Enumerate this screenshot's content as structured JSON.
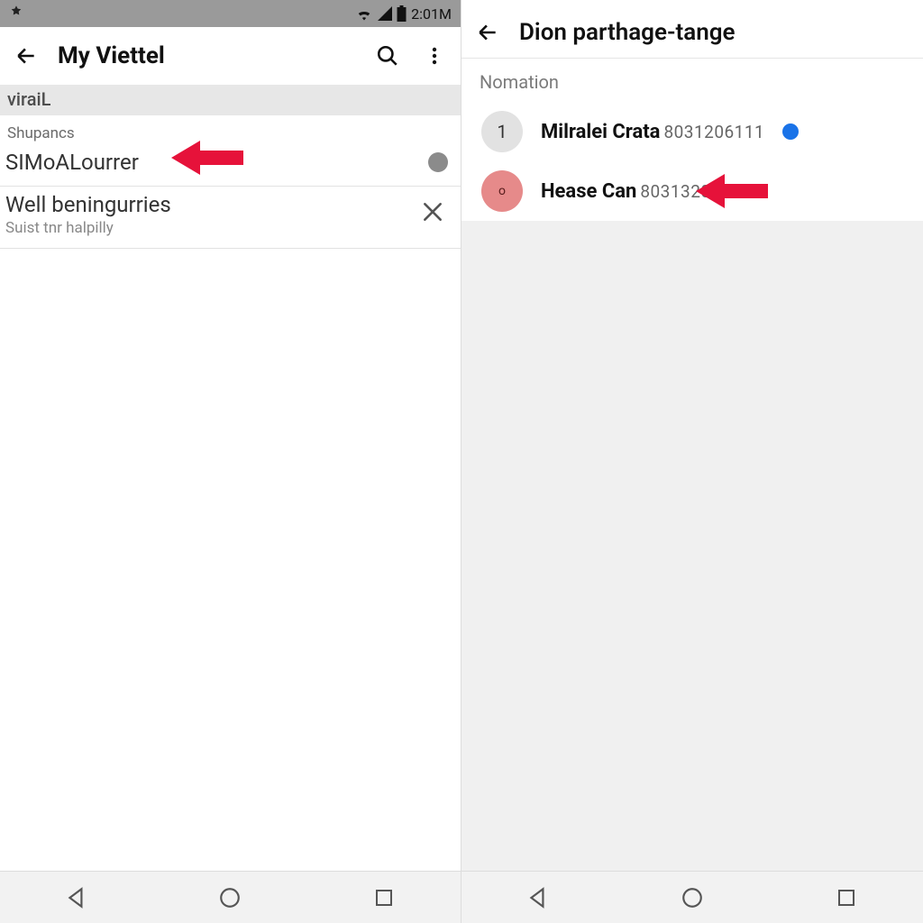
{
  "left": {
    "status": {
      "time": "2:01M"
    },
    "appbar": {
      "title": "My Viettel"
    },
    "strip_label": "viraiL",
    "section_small": "Shupancs",
    "row1": {
      "primary": "SIMoALourrer"
    },
    "row2": {
      "primary": "Well beningurries",
      "secondary": "Suist tnr halpilly"
    }
  },
  "right": {
    "appbar": {
      "title": "Dion parthage-tange"
    },
    "section_label": "Nomation",
    "contacts": [
      {
        "avatar": "1",
        "name": "Milralei Crata",
        "sub": "8031206111",
        "selected": true
      },
      {
        "avatar": "o",
        "name": "Hease Can",
        "sub": "8031320445",
        "selected": false
      }
    ]
  }
}
